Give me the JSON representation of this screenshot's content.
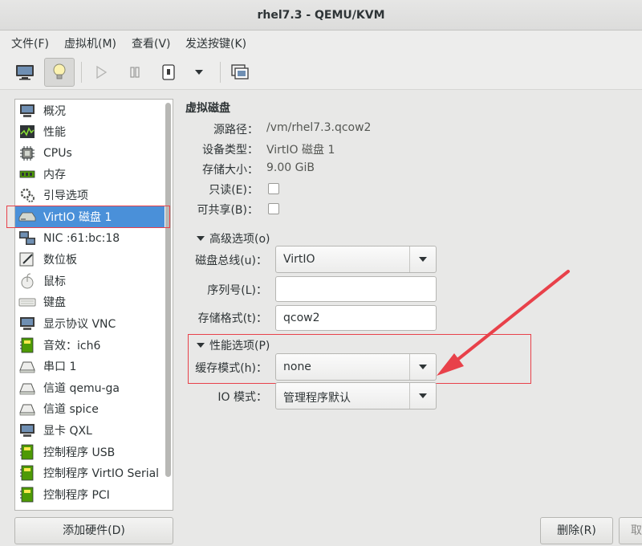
{
  "window": {
    "title": "rhel7.3 - QEMU/KVM"
  },
  "menu": [
    {
      "label": "文件(F)"
    },
    {
      "label": "虚拟机(M)"
    },
    {
      "label": "查看(V)"
    },
    {
      "label": "发送按键(K)"
    }
  ],
  "sidebar": {
    "items": [
      {
        "label": "概况",
        "icon": "overview-icon"
      },
      {
        "label": "性能",
        "icon": "performance-icon"
      },
      {
        "label": "CPUs",
        "icon": "cpu-icon"
      },
      {
        "label": "内存",
        "icon": "memory-icon"
      },
      {
        "label": "引导选项",
        "icon": "boot-options-icon"
      },
      {
        "label": "VirtIO 磁盘 1",
        "icon": "disk-icon",
        "selected": true
      },
      {
        "label": "NIC :61:bc:18",
        "icon": "network-icon"
      },
      {
        "label": "数位板",
        "icon": "tablet-icon"
      },
      {
        "label": "鼠标",
        "icon": "mouse-icon"
      },
      {
        "label": "键盘",
        "icon": "keyboard-icon"
      },
      {
        "label": "显示协议 VNC",
        "icon": "display-icon"
      },
      {
        "label": "音效：ich6",
        "icon": "sound-icon"
      },
      {
        "label": "串口 1",
        "icon": "serial-icon"
      },
      {
        "label": "信道 qemu-ga",
        "icon": "channel-icon"
      },
      {
        "label": "信道 spice",
        "icon": "channel-icon"
      },
      {
        "label": "显卡 QXL",
        "icon": "video-icon"
      },
      {
        "label": "控制程序 USB",
        "icon": "controller-icon"
      },
      {
        "label": "控制程序 VirtIO Serial",
        "icon": "controller-icon"
      },
      {
        "label": "控制程序 PCI",
        "icon": "controller-icon"
      }
    ],
    "add_hardware": "添加硬件(D)"
  },
  "detail": {
    "title": "虚拟磁盘",
    "source_path_label": "源路径：",
    "source_path": "/vm/rhel7.3.qcow2",
    "device_type_label": "设备类型：",
    "device_type": "VirtIO 磁盘 1",
    "storage_size_label": "存储大小：",
    "storage_size": "9.00 GiB",
    "readonly_label": "只读(E)：",
    "shareable_label": "可共享(B)：",
    "advanced_label": "高级选项(o)",
    "disk_bus_label": "磁盘总线(u)：",
    "disk_bus": "VirtIO",
    "serial_label": "序列号(L)：",
    "serial": "",
    "format_label": "存储格式(t)：",
    "format": "qcow2",
    "perf_label": "性能选项(P)",
    "cache_label": "缓存模式(h)：",
    "cache": "none",
    "io_label": "IO 模式：",
    "io": "管理程序默认"
  },
  "buttons": {
    "remove": "删除(R)",
    "cancel": "取"
  },
  "colors": {
    "selection": "#4a90d9",
    "annotation": "#e8414a"
  }
}
